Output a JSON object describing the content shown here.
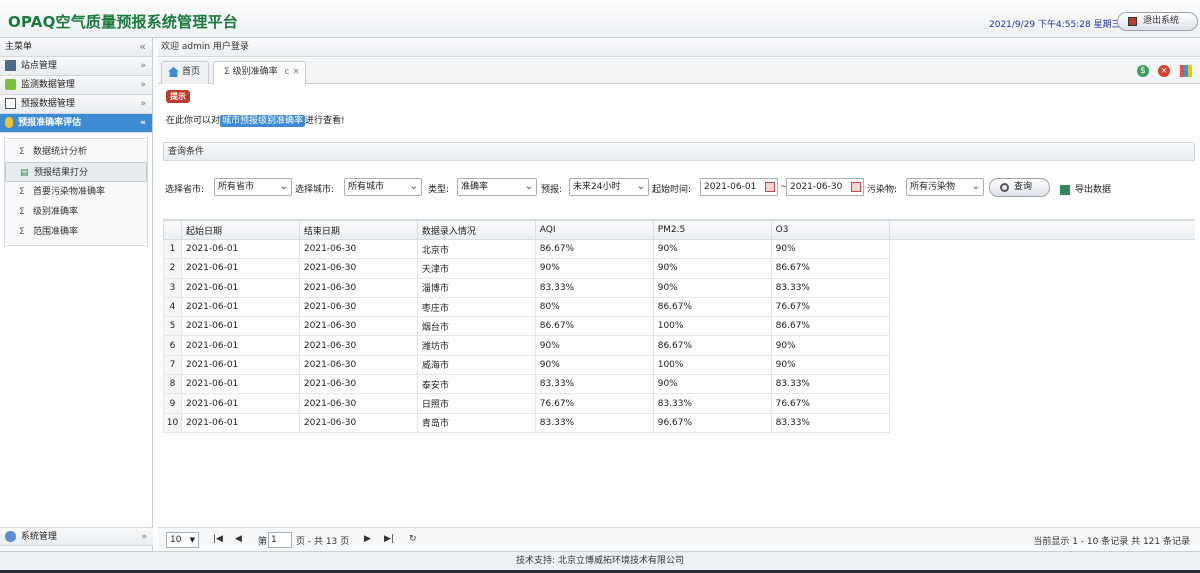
{
  "header": {
    "title": "OPAQ空气质量预报系统管理平台",
    "datetime": "2021/9/29 下午4:55:28 星期三",
    "logout_label": "退出系统"
  },
  "sidebar": {
    "title": "主菜单",
    "collapse_icon": "double-chevron-left-icon",
    "sections": [
      {
        "label": "站点管理"
      },
      {
        "label": "监测数据管理"
      },
      {
        "label": "预报数据管理"
      },
      {
        "label": "预报准确率评估"
      }
    ],
    "sub_items": [
      {
        "label": "数据统计分析"
      },
      {
        "label": "预报结果打分"
      },
      {
        "label": "首要污染物准确率"
      },
      {
        "label": "级别准确率"
      },
      {
        "label": "范围准确率"
      }
    ],
    "bottom_section": {
      "label": "系统管理"
    }
  },
  "main": {
    "welcome": "欢迎 admin 用户登录",
    "tabs": [
      {
        "label": "首页"
      },
      {
        "label": "级别准确率"
      }
    ]
  },
  "tip": {
    "badge": "提示",
    "prefix": "在此你可以对",
    "highlight": "城市预报级别准确率",
    "suffix": "进行查看!"
  },
  "query": {
    "header": "查询条件",
    "province_label": "选择省市:",
    "province_value": "所有省市",
    "city_label": "选择城市:",
    "city_value": "所有城市",
    "type_label": "类型:",
    "type_value": "准确率",
    "forecast_label": "预报:",
    "forecast_value": "未来24小时",
    "start_label": "起始时间:",
    "start_value": "2021-06-01",
    "sep": "~",
    "end_value": "2021-06-30",
    "pollutant_label": "污染物:",
    "pollutant_value": "所有污染物",
    "search_label": "查询",
    "export_label": "导出数据"
  },
  "table": {
    "columns": [
      "起始日期",
      "结束日期",
      "数据录入情况",
      "AQI",
      "PM2.5",
      "O3"
    ],
    "rows": [
      [
        "1",
        "2021-06-01",
        "2021-06-30",
        "北京市",
        "86.67%",
        "90%",
        "90%"
      ],
      [
        "2",
        "2021-06-01",
        "2021-06-30",
        "天津市",
        "90%",
        "90%",
        "86.67%"
      ],
      [
        "3",
        "2021-06-01",
        "2021-06-30",
        "淄博市",
        "83.33%",
        "90%",
        "83.33%"
      ],
      [
        "4",
        "2021-06-01",
        "2021-06-30",
        "枣庄市",
        "80%",
        "86.67%",
        "76.67%"
      ],
      [
        "5",
        "2021-06-01",
        "2021-06-30",
        "烟台市",
        "86.67%",
        "100%",
        "86.67%"
      ],
      [
        "6",
        "2021-06-01",
        "2021-06-30",
        "潍坊市",
        "90%",
        "86.67%",
        "90%"
      ],
      [
        "7",
        "2021-06-01",
        "2021-06-30",
        "威海市",
        "90%",
        "100%",
        "90%"
      ],
      [
        "8",
        "2021-06-01",
        "2021-06-30",
        "泰安市",
        "83.33%",
        "90%",
        "83.33%"
      ],
      [
        "9",
        "2021-06-01",
        "2021-06-30",
        "日照市",
        "76.67%",
        "83.33%",
        "76.67%"
      ],
      [
        "10",
        "2021-06-01",
        "2021-06-30",
        "青岛市",
        "83.33%",
        "96.67%",
        "83.33%"
      ]
    ]
  },
  "pager": {
    "page_size": "10",
    "page_prefix": "第",
    "page_no": "1",
    "page_suffix": "页 - 共 13 页",
    "summary": "当前显示 1 - 10 条记录 共 121 条记录"
  },
  "footer": {
    "text": "技术支持:  北京立博威拓环境技术有限公司"
  },
  "colors": {
    "brand": "#1a7a3a",
    "accent": "#3d8bd4",
    "tip_badge": "#c0392b"
  }
}
